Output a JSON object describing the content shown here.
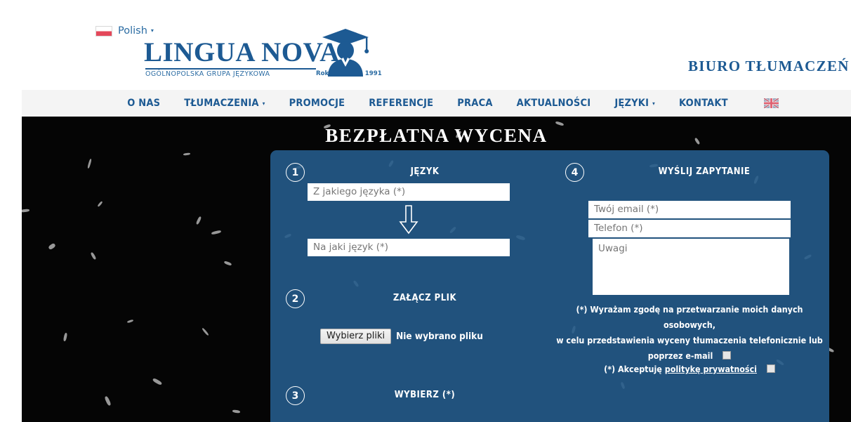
{
  "header": {
    "language_switcher": {
      "flag": "flag-poland-icon",
      "label": "Polish",
      "caret": "▾"
    },
    "logo": {
      "wordmark": "LINGUA NOVA",
      "registered_mark": "®",
      "tagline": "OGÓLNOPOLSKA GRUPA JĘZYKOWA",
      "since": "Rok założenia 1991",
      "graduate_icon": "graduate-silhouette-icon"
    },
    "site_tagline": "BIURO TŁUMACZEŃ"
  },
  "nav": {
    "items": [
      {
        "label": "O NAS",
        "has_dropdown": false
      },
      {
        "label": "TŁUMACZENIA",
        "has_dropdown": true,
        "caret": "▾"
      },
      {
        "label": "PROMOCJE",
        "has_dropdown": false
      },
      {
        "label": "REFERENCJE",
        "has_dropdown": false
      },
      {
        "label": "PRACA",
        "has_dropdown": false
      },
      {
        "label": "AKTUALNOŚCI",
        "has_dropdown": false
      },
      {
        "label": "JĘZYKI",
        "has_dropdown": true,
        "caret": "▾"
      },
      {
        "label": "KONTAKT",
        "has_dropdown": false
      }
    ],
    "flag_button": "flag-uk-icon"
  },
  "hero": {
    "title": "BEZPŁATNA WYCENA",
    "background_color": "#050505"
  },
  "form": {
    "panel_color": "#21527d",
    "step1": {
      "number": "1",
      "title": "JĘZYK",
      "from_placeholder": "Z jakiego języka (*)",
      "from_value": "",
      "to_placeholder": "Na jaki język (*)",
      "to_value": "",
      "arrow_icon": "arrow-down-icon"
    },
    "step2": {
      "number": "2",
      "title": "ZAŁĄCZ PLIK",
      "button_label": "Wybierz pliki",
      "status_text": "Nie wybrano pliku"
    },
    "step3": {
      "number": "3",
      "title": "WYBIERZ (*)"
    },
    "step4": {
      "number": "4",
      "title": "WYŚLIJ ZAPYTANIE",
      "email_placeholder": "Twój email (*)",
      "email_value": "",
      "phone_placeholder": "Telefon (*)",
      "phone_value": "",
      "notes_placeholder": "Uwagi",
      "notes_value": ""
    },
    "consent": {
      "line1": "(*) Wyrażam zgodę na przetwarzanie moich danych osobowych,",
      "line2": "w celu przedstawienia wyceny tłumaczenia telefonicznie lub",
      "line3": "poprzez e-mail",
      "checked": false
    },
    "policy": {
      "prefix": "(*) Akceptuję",
      "link_text": "politykę prywatności",
      "checked": false
    }
  },
  "colors": {
    "brand_blue": "#1d5a93",
    "panel_blue": "#21527d",
    "nav_bg": "#f4f4f4",
    "hero_black": "#050505"
  }
}
